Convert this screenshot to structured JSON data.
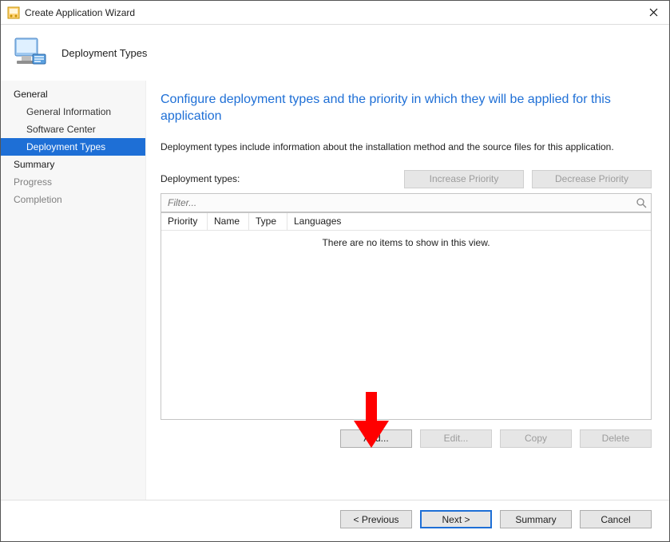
{
  "window": {
    "title": "Create Application Wizard"
  },
  "header": {
    "step_title": "Deployment Types"
  },
  "nav": {
    "items": [
      {
        "label": "General",
        "kind": "section"
      },
      {
        "label": "General Information",
        "kind": "sub"
      },
      {
        "label": "Software Center",
        "kind": "sub"
      },
      {
        "label": "Deployment Types",
        "kind": "sub",
        "selected": true
      },
      {
        "label": "Summary",
        "kind": "section"
      },
      {
        "label": "Progress",
        "kind": "section",
        "disabled": true
      },
      {
        "label": "Completion",
        "kind": "section",
        "disabled": true
      }
    ]
  },
  "page": {
    "headline": "Configure deployment types and the priority in which they will be applied for this application",
    "description": "Deployment types include information about the installation method and the source files for this application.",
    "dt_label": "Deployment types:",
    "increase_priority_label": "Increase Priority",
    "decrease_priority_label": "Decrease Priority",
    "filter_placeholder": "Filter...",
    "columns": [
      "Priority",
      "Name",
      "Type",
      "Languages"
    ],
    "empty_text": "There are no items to show in this view.",
    "add_label": "Add...",
    "edit_label": "Edit...",
    "copy_label": "Copy",
    "delete_label": "Delete"
  },
  "footer": {
    "previous_label": "< Previous",
    "next_label": "Next >",
    "summary_label": "Summary",
    "cancel_label": "Cancel"
  }
}
